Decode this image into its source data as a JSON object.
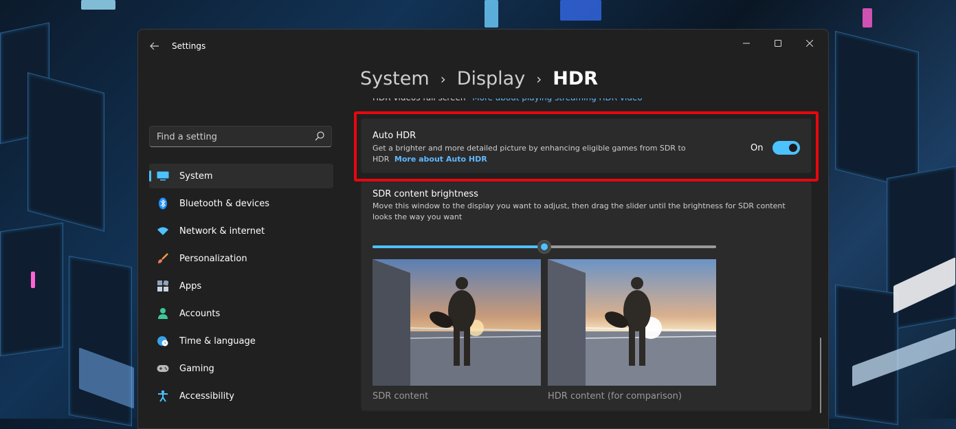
{
  "window": {
    "app_title": "Settings",
    "back_icon": "back-arrow-icon",
    "minimize_icon": "minimize-icon",
    "maximize_icon": "maximize-icon",
    "close_icon": "close-icon"
  },
  "search": {
    "placeholder": "Find a setting",
    "icon": "search-icon"
  },
  "sidebar": {
    "items": [
      {
        "label": "System",
        "icon": "monitor-icon",
        "active": true
      },
      {
        "label": "Bluetooth & devices",
        "icon": "bluetooth-icon"
      },
      {
        "label": "Network & internet",
        "icon": "wifi-icon"
      },
      {
        "label": "Personalization",
        "icon": "brush-icon"
      },
      {
        "label": "Apps",
        "icon": "apps-icon"
      },
      {
        "label": "Accounts",
        "icon": "person-icon"
      },
      {
        "label": "Time & language",
        "icon": "globe-clock-icon"
      },
      {
        "label": "Gaming",
        "icon": "gamepad-icon"
      },
      {
        "label": "Accessibility",
        "icon": "accessibility-icon"
      }
    ]
  },
  "breadcrumb": {
    "items": [
      "System",
      "Display"
    ],
    "separator": "›",
    "current": "HDR"
  },
  "prev_card": {
    "text": "HDR videos full screen",
    "link": "More about playing streaming HDR video"
  },
  "auto_hdr": {
    "title": "Auto HDR",
    "desc_line1": "Get a brighter and more detailed picture by enhancing eligible games from SDR to",
    "desc_line2": "HDR",
    "link": "More about Auto HDR",
    "state": "On",
    "enabled": true
  },
  "sdr_brightness": {
    "title": "SDR content brightness",
    "desc_line1": "Move this window to the display you want to adjust, then drag the slider until the brightness for SDR content",
    "desc_line2": "looks the way you want",
    "slider_level": 0.5,
    "preview_sdr_caption": "SDR content",
    "preview_hdr_caption": "HDR content (for comparison)"
  },
  "colors": {
    "accent": "#4cc2ff",
    "link": "#60b8ff",
    "highlight": "#e8070f",
    "window_bg": "#202020",
    "card_bg": "#2b2b2b"
  }
}
